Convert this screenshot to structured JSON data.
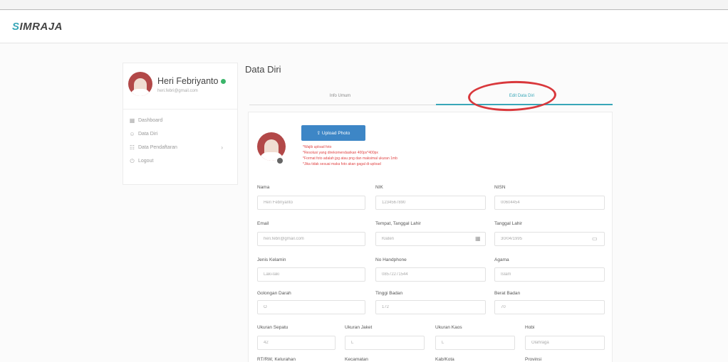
{
  "app": {
    "logo_letter": "S",
    "logo_rest": "IMRAJA",
    "accent": "#39a7b8"
  },
  "sidebar": {
    "user_name": "Heri Febriyanto",
    "user_email": "heri.febri@gmail.com",
    "items": [
      {
        "icon": "dashboard-icon",
        "glyph": "▦",
        "label": "Dashboard"
      },
      {
        "icon": "user-icon",
        "glyph": "☺",
        "label": "Data Diri"
      },
      {
        "icon": "list-icon",
        "glyph": "☷",
        "label": "Data Pendaftaran",
        "chevron": "›"
      },
      {
        "icon": "logout-icon",
        "glyph": "⏻",
        "label": "Logout"
      }
    ]
  },
  "main": {
    "title": "Data Diri",
    "tabs": [
      {
        "label": "Info Umum"
      },
      {
        "label": "Edit Data Diri"
      }
    ],
    "upload_button": "⇪ Upload Photo",
    "notes": [
      "*Wajib upload foto",
      "*Resolusi yang direkomendasikan 400px*400px",
      "*Format foto adalah jpg atau png dan maksimal ukuran 1mb",
      "*Jika tidak sesuai maka foto akan gagal di-upload"
    ],
    "fields": {
      "nama": {
        "label": "Nama",
        "value": "Heri Febriyanto"
      },
      "nik": {
        "label": "NIK",
        "value": "1234567890"
      },
      "nisn": {
        "label": "NISN",
        "value": "00604454"
      },
      "email": {
        "label": "Email",
        "value": "heri.febri@gmail.com"
      },
      "tempat": {
        "label": "Tempat, Tanggal Lahir",
        "value": "Klaten"
      },
      "tanggal": {
        "label": "Tanggal Lahir",
        "value": "30/04/1995"
      },
      "jenis": {
        "label": "Jenis Kelamin",
        "value": "Laki-laki"
      },
      "hp": {
        "label": "No Handphone",
        "value": "08572271544"
      },
      "agama": {
        "label": "Agama",
        "value": "Islam"
      },
      "golongan": {
        "label": "Golongan Darah",
        "value": "O"
      },
      "tinggi": {
        "label": "Tinggi Badan",
        "value": "172"
      },
      "berat": {
        "label": "Berat Badan",
        "value": "70"
      },
      "sepatu": {
        "label": "Ukuran Sepatu",
        "value": "42"
      },
      "jaket": {
        "label": "Ukuran Jaket",
        "value": "L"
      },
      "kaos": {
        "label": "Ukuran Kaos",
        "value": "L"
      },
      "hobi": {
        "label": "Hobi",
        "value": "Olahraga"
      },
      "rtrw": {
        "label": "RT/RW, Kelurahan"
      },
      "kecamatan": {
        "label": "Kecamatan"
      },
      "kabkota": {
        "label": "Kab/Kota"
      },
      "provinsi": {
        "label": "Provinsi"
      }
    }
  }
}
